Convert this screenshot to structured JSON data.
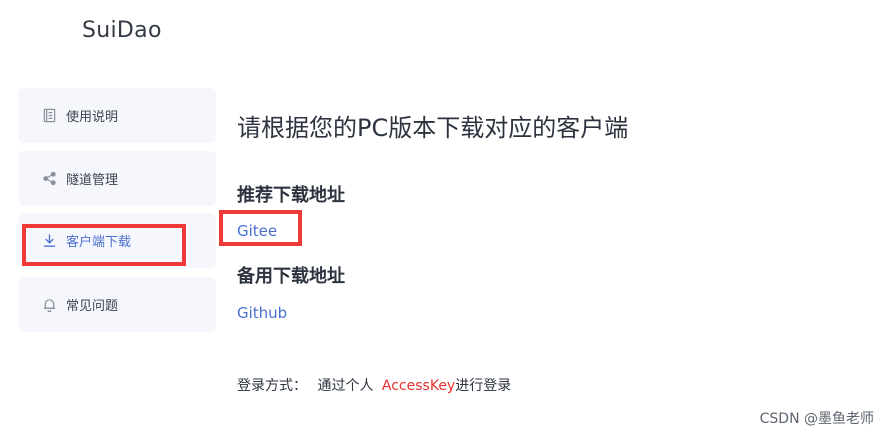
{
  "app": {
    "logo": "SuiDao"
  },
  "sidebar": {
    "items": [
      {
        "label": "使用说明",
        "icon": "document-icon"
      },
      {
        "label": "隧道管理",
        "icon": "share-icon"
      },
      {
        "label": "客户端下载",
        "icon": "download-icon",
        "active": true
      },
      {
        "label": "常见问题",
        "icon": "bell-icon"
      }
    ]
  },
  "main": {
    "title": "请根据您的PC版本下载对应的客户端",
    "recommended": {
      "heading": "推荐下载地址",
      "link": "Gitee"
    },
    "backup": {
      "heading": "备用下载地址",
      "link": "Github"
    },
    "login": {
      "prefix": "登录方式：",
      "middle": "通过个人",
      "key": "AccessKey",
      "suffix": "进行登录"
    }
  },
  "watermark": "CSDN @墨鱼老师",
  "colors": {
    "accent": "#4a6fd0",
    "highlight": "#f03a3a",
    "nav_bg": "#f5f7fc"
  }
}
